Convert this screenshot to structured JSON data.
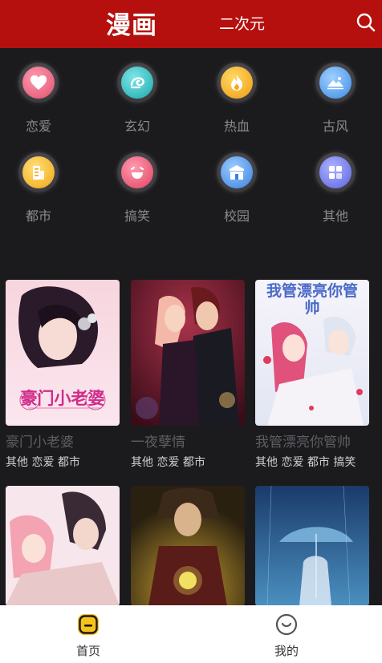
{
  "header": {
    "tabs": [
      {
        "label": "漫画",
        "active": true
      },
      {
        "label": "二次元",
        "active": false
      }
    ],
    "search_icon": "search-icon",
    "bg_color": "#b5100e"
  },
  "categories": [
    {
      "label": "恋爱",
      "icon": "heart-icon",
      "color": "#f06b86"
    },
    {
      "label": "玄幻",
      "icon": "swirl-icon",
      "color": "#2fc7c9"
    },
    {
      "label": "热血",
      "icon": "flame-icon",
      "color": "#f5b31c"
    },
    {
      "label": "古风",
      "icon": "landscape-icon",
      "color": "#5aaaf2"
    },
    {
      "label": "都市",
      "icon": "building-icon",
      "color": "#f4b82a"
    },
    {
      "label": "搞笑",
      "icon": "laugh-icon",
      "color": "#f0607b"
    },
    {
      "label": "校园",
      "icon": "school-icon",
      "color": "#4e9bf0"
    },
    {
      "label": "其他",
      "icon": "grid-icon",
      "color": "#7b82f0"
    }
  ],
  "comics": [
    {
      "title": "豪门小老婆",
      "tags": "其他 恋爱 都市",
      "cover_text": "豪门小老婆"
    },
    {
      "title": "一夜孽情",
      "tags": "其他 恋爱 都市",
      "cover_text": ""
    },
    {
      "title": "我管漂亮你管帅",
      "tags": "其他 恋爱 都市 搞笑",
      "cover_text": "我管漂亮你管帅"
    },
    {
      "title": "",
      "tags": "",
      "cover_text": ""
    },
    {
      "title": "",
      "tags": "",
      "cover_text": ""
    },
    {
      "title": "",
      "tags": "",
      "cover_text": ""
    }
  ],
  "bottom_nav": [
    {
      "label": "首页",
      "icon": "home-icon",
      "active": true
    },
    {
      "label": "我的",
      "icon": "profile-icon",
      "active": false
    }
  ]
}
